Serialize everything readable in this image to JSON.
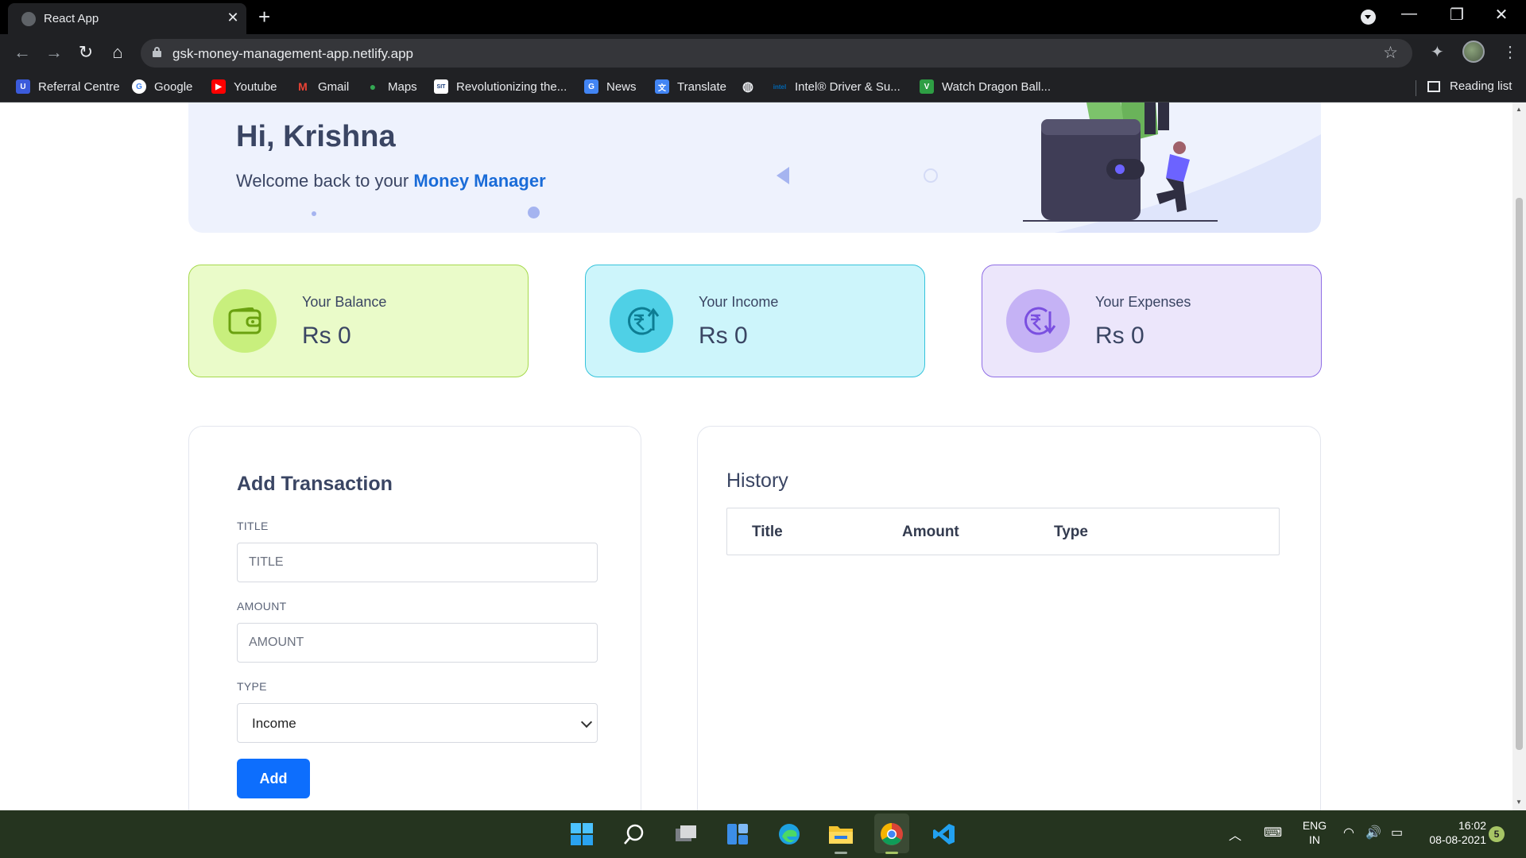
{
  "browser": {
    "tab": {
      "title": "React App",
      "close": "✕"
    },
    "new_tab": "+",
    "url": "gsk-money-management-app.netlify.app",
    "window_controls": {
      "minimize": "—",
      "restore": "❐",
      "close": "✕"
    },
    "bookmarks": [
      {
        "label": "Referral Centre",
        "icon": "referral-icon",
        "color": "#3b5bdb"
      },
      {
        "label": "Google",
        "icon": "google-icon",
        "color": "#4285f4"
      },
      {
        "label": "Youtube",
        "icon": "youtube-icon",
        "color": "#ff0000"
      },
      {
        "label": "Gmail",
        "icon": "gmail-icon",
        "color": "#ea4335"
      },
      {
        "label": "Maps",
        "icon": "maps-icon",
        "color": "#34a853"
      },
      {
        "label": "Revolutionizing the...",
        "icon": "site-icon",
        "color": "#ffffff"
      },
      {
        "label": "News",
        "icon": "news-icon",
        "color": "#4285f4"
      },
      {
        "label": "Translate",
        "icon": "translate-icon",
        "color": "#4285f4"
      },
      {
        "label": "",
        "icon": "globe-icon",
        "color": "#e8eaed"
      },
      {
        "label": "Intel® Driver & Su...",
        "icon": "intel-icon",
        "color": "#0068b5"
      },
      {
        "label": "Watch Dragon Ball...",
        "icon": "dragonball-icon",
        "color": "#2e9e44"
      }
    ],
    "reading_list": "Reading list"
  },
  "banner": {
    "greeting": "Hi, Krishna",
    "welcome_prefix": "Welcome back to your",
    "brand": "Money Manager"
  },
  "stats": [
    {
      "label": "Your Balance",
      "value": "Rs 0",
      "icon": "wallet-icon",
      "bg": "#eafbc9",
      "border": "#a6d94c",
      "circle": "#c8ef7d",
      "accent": "#6aa10f"
    },
    {
      "label": "Your Income",
      "value": "Rs 0",
      "icon": "income-rupee-icon",
      "bg": "#cdf5fb",
      "border": "#35c3db",
      "circle": "#4fd0e6",
      "accent": "#0d7d93"
    },
    {
      "label": "Your Expenses",
      "value": "Rs 0",
      "icon": "expense-rupee-icon",
      "bg": "#ece6fb",
      "border": "#8f6de5",
      "circle": "#c5b2f5",
      "accent": "#7a4fe0"
    }
  ],
  "transaction_form": {
    "title": "Add Transaction",
    "title_label": "TITLE",
    "title_placeholder": "TITLE",
    "amount_label": "AMOUNT",
    "amount_placeholder": "AMOUNT",
    "type_label": "TYPE",
    "type_value": "Income",
    "submit": "Add"
  },
  "history": {
    "title": "History",
    "columns": [
      "Title",
      "Amount",
      "Type"
    ]
  },
  "taskbar": {
    "language": "ENG",
    "region": "IN",
    "time": "16:02",
    "date": "08-08-2021",
    "notifications": "5"
  }
}
